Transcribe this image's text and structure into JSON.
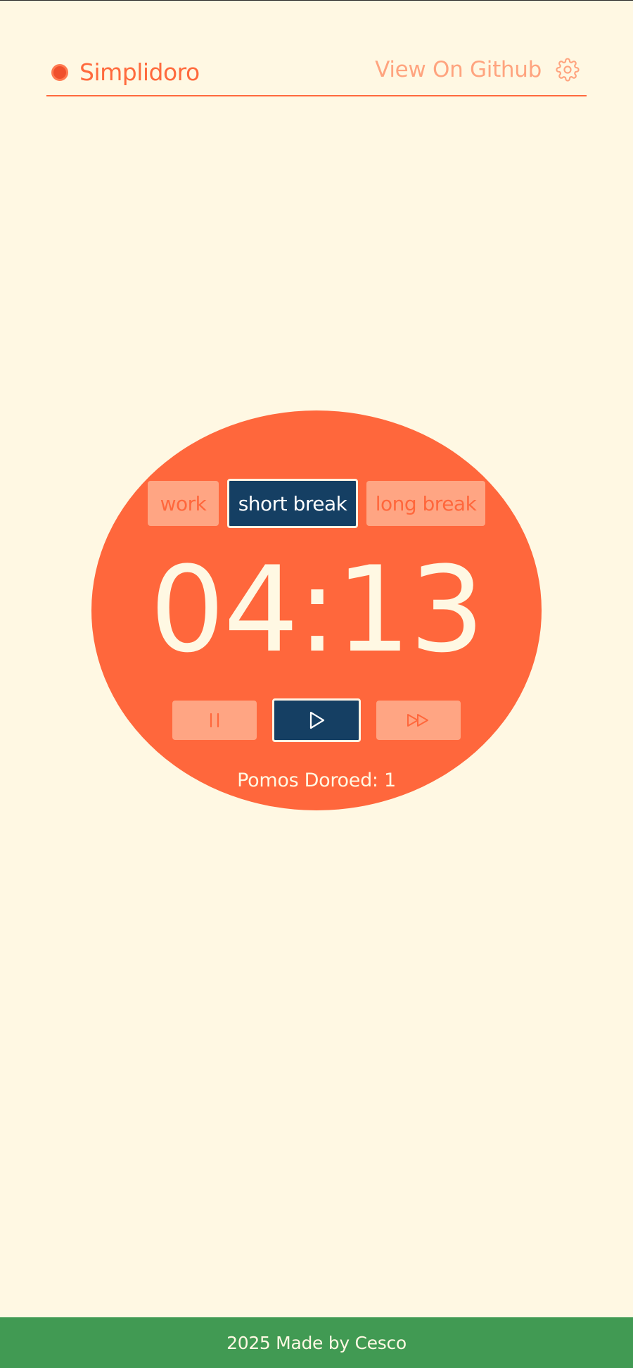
{
  "header": {
    "brand_title": "Simplidoro",
    "github_label": "View On Github",
    "settings_icon": "gear-icon"
  },
  "timer": {
    "modes": [
      {
        "label": "work",
        "active": false
      },
      {
        "label": "short break",
        "active": true
      },
      {
        "label": "long break",
        "active": false
      }
    ],
    "time": "04:13",
    "controls": [
      {
        "icon": "pause-icon",
        "active": false
      },
      {
        "icon": "play-icon",
        "active": true
      },
      {
        "icon": "skip-forward-icon",
        "active": false
      }
    ],
    "pomos_label": "Pomos Doroed: 1"
  },
  "footer": {
    "text": "2025 Made by Cesco"
  },
  "colors": {
    "background": "#fff8e3",
    "accent": "#ff673c",
    "tab_inactive": "#ffa583",
    "tab_active": "#153f63",
    "footer": "#419a53"
  }
}
